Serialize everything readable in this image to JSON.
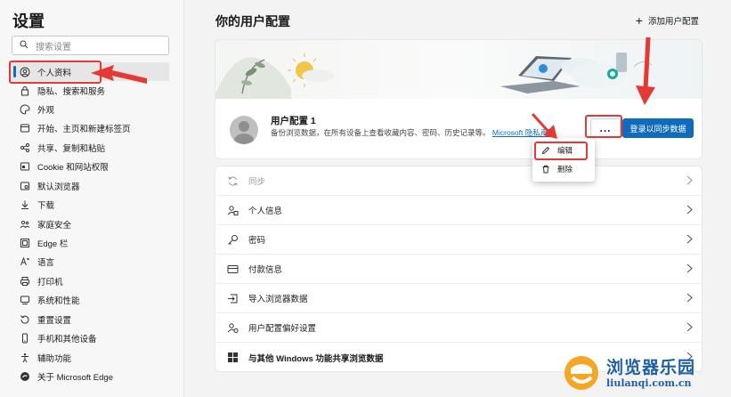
{
  "sidebar": {
    "title": "设置",
    "search_placeholder": "搜索设置",
    "items": [
      {
        "label": "个人资料",
        "icon": "person-circle-icon",
        "active": true
      },
      {
        "label": "隐私、搜索和服务",
        "icon": "lock-icon"
      },
      {
        "label": "外观",
        "icon": "palette-icon"
      },
      {
        "label": "开始、主页和新建标签页",
        "icon": "home-tab-icon"
      },
      {
        "label": "共享、复制和粘贴",
        "icon": "share-icon"
      },
      {
        "label": "Cookie 和网站权限",
        "icon": "site-permissions-icon"
      },
      {
        "label": "默认浏览器",
        "icon": "browser-icon"
      },
      {
        "label": "下载",
        "icon": "download-icon"
      },
      {
        "label": "家庭安全",
        "icon": "family-icon"
      },
      {
        "label": "Edge 栏",
        "icon": "edge-bar-icon"
      },
      {
        "label": "语言",
        "icon": "language-icon"
      },
      {
        "label": "打印机",
        "icon": "printer-icon"
      },
      {
        "label": "系统和性能",
        "icon": "system-icon"
      },
      {
        "label": "重置设置",
        "icon": "reset-icon"
      },
      {
        "label": "手机和其他设备",
        "icon": "phone-icon"
      },
      {
        "label": "辅助功能",
        "icon": "accessibility-icon"
      },
      {
        "label": "关于 Microsoft Edge",
        "icon": "edge-logo-icon"
      }
    ]
  },
  "main": {
    "title": "你的用户配置",
    "add_profile": "添加用户配置",
    "profile": {
      "name": "用户配置 1",
      "description": "备份浏览数据，在所有设备上查看收藏内容、密码、历史记录等。",
      "link": "Microsoft 隐私声明",
      "more": "...",
      "signin": "登录以同步数据"
    },
    "menu": {
      "edit": "编辑",
      "delete": "删除"
    },
    "rows": [
      {
        "label": "同步",
        "icon": "sync-icon",
        "disabled": true
      },
      {
        "label": "个人信息",
        "icon": "personal-info-icon"
      },
      {
        "label": "密码",
        "icon": "key-icon"
      },
      {
        "label": "付款信息",
        "icon": "card-icon"
      },
      {
        "label": "导入浏览器数据",
        "icon": "import-icon"
      },
      {
        "label": "用户配置偏好设置",
        "icon": "profile-prefs-icon"
      },
      {
        "label": "与其他 Windows 功能共享浏览数据",
        "icon": "windows-icon"
      }
    ]
  },
  "watermark": {
    "title": "浏览器乐园",
    "url": "liulanqi.com.cn"
  },
  "colors": {
    "accent": "#0f6cbd",
    "annotation": "#e53935",
    "watermark": "#1e5fa8",
    "watermark_logo": "#f5a623"
  }
}
